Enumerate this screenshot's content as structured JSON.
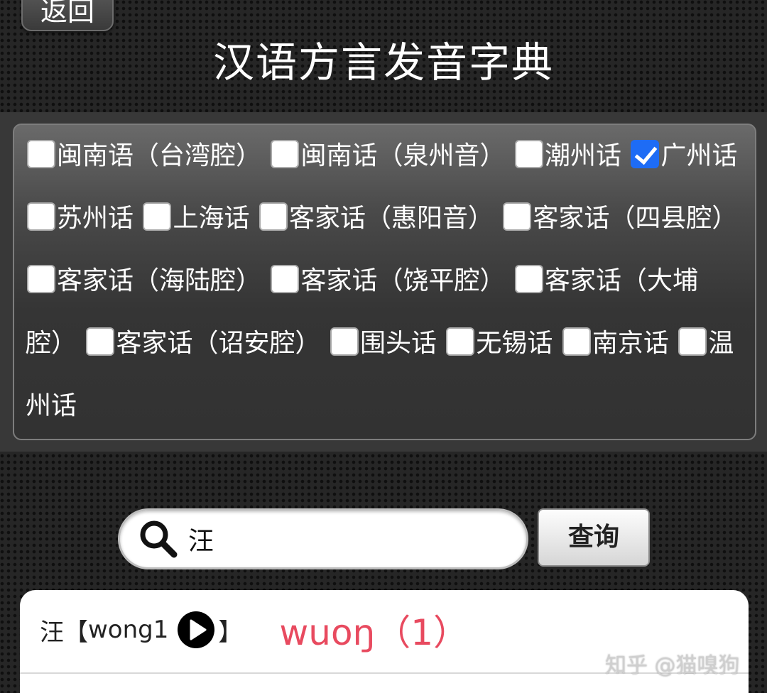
{
  "header": {
    "back_label": "返回",
    "title": "汉语方言发音字典"
  },
  "dialects": [
    {
      "label": "闽南语（台湾腔）",
      "checked": false
    },
    {
      "label": "闽南话（泉州音）",
      "checked": false
    },
    {
      "label": "潮州话",
      "checked": false
    },
    {
      "label": "广州话",
      "checked": true
    },
    {
      "label": "苏州话",
      "checked": false
    },
    {
      "label": "上海话",
      "checked": false
    },
    {
      "label": "客家话（惠阳音）",
      "checked": false
    },
    {
      "label": "客家话（四县腔）",
      "checked": false
    },
    {
      "label": "客家话（海陆腔）",
      "checked": false
    },
    {
      "label": "客家话（饶平腔）",
      "checked": false
    },
    {
      "label": "客家话（大埔腔）",
      "checked": false
    },
    {
      "label": "客家话（诏安腔）",
      "checked": false
    },
    {
      "label": "围头话",
      "checked": false
    },
    {
      "label": "无锡话",
      "checked": false
    },
    {
      "label": "南京话",
      "checked": false
    },
    {
      "label": "温州话",
      "checked": false
    }
  ],
  "search": {
    "value": "汪",
    "query_label": "查询"
  },
  "result": {
    "character": "汪",
    "open_bracket": "【",
    "romanization": "wong1",
    "close_bracket": "】",
    "ipa": "wuoŋ（1）"
  },
  "watermark": "知乎 @猫嗅狗"
}
